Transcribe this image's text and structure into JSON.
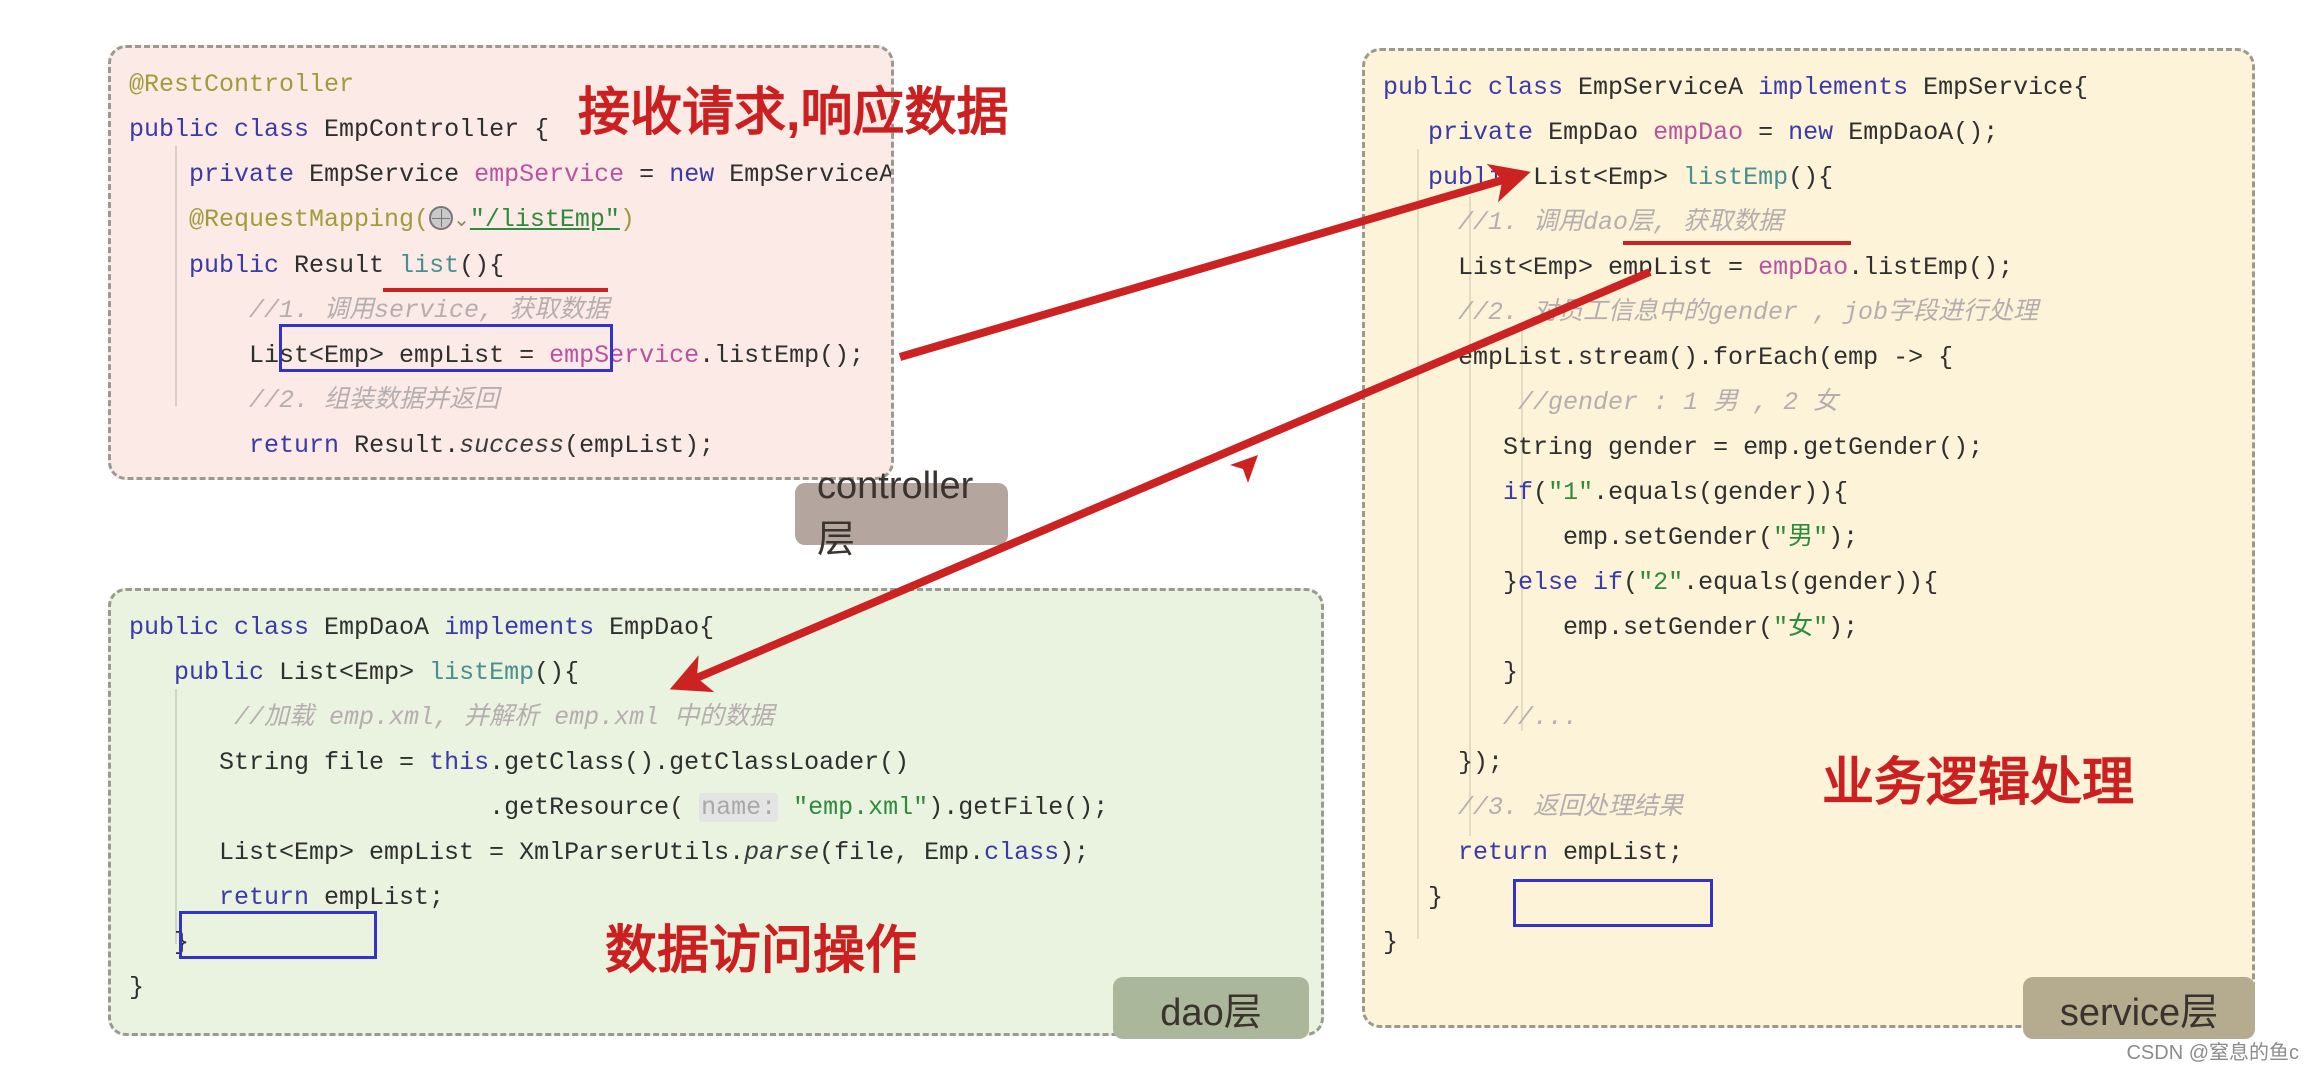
{
  "panels": {
    "controller": {
      "layer_badge": "controller层",
      "annotation": "接收请求,响应数据",
      "background": "#fbeae6",
      "lines": {
        "l1_annotation": "@RestController",
        "l2_class": "public class EmpController {",
        "l3_field": "private EmpService empService = new EmpServiceA();",
        "l4_mapping_prefix": "@RequestMapping(",
        "l4_mapping_path": "\"/listEmp\"",
        "l4_mapping_suffix": ")",
        "l5_method": "public Result list(){",
        "l6_comment": "//1. 调用service, 获取数据",
        "l7_call": "List<Emp> empList = empService.listEmp();",
        "l8_comment": "//2. 组装数据并返回",
        "l9_return": "return Result.success(empList);",
        "l10_brace": "}",
        "l11_brace": "}"
      }
    },
    "dao": {
      "layer_badge": "dao层",
      "annotation": "数据访问操作",
      "background": "#eaf2e0",
      "lines": {
        "l1_class": "public class EmpDaoA implements EmpDao{",
        "l2_method": "public List<Emp> listEmp(){",
        "l3_comment": "//加载 emp.xml, 并解析 emp.xml 中的数据",
        "l4_code": "String file = this.getClass().getClassLoader()",
        "l5_code_prefix": ".getResource(",
        "l5_hint": "name:",
        "l5_code_suffix": "\"emp.xml\").getFile();",
        "l6_code": "List<Emp> empList = XmlParserUtils.parse(file, Emp.class);",
        "l7_return": "return empList;",
        "l8_brace": "}",
        "l9_brace": "}"
      }
    },
    "service": {
      "layer_badge": "service层",
      "annotation": "业务逻辑处理",
      "background": "#fcf3d9",
      "lines": {
        "l1_class": "public class EmpServiceA implements EmpService{",
        "l2_field": "private EmpDao empDao = new EmpDaoA();",
        "l3_method": "public List<Emp> listEmp(){",
        "l4_comment": "//1. 调用dao层, 获取数据",
        "l5_call": "List<Emp> empList = empDao.listEmp();",
        "l6_comment": "//2. 对员工信息中的gender , job字段进行处理",
        "l7_stream": "empList.stream().forEach(emp -> {",
        "l8_comment": "//gender : 1 男 , 2 女",
        "l9_code": "String gender = emp.getGender();",
        "l10_if": "if(\"1\".equals(gender)){",
        "l11_set": "emp.setGender(\"男\");",
        "l12_elseif": "}else if(\"2\".equals(gender)){",
        "l13_set": "emp.setGender(\"女\");",
        "l14_brace": "}",
        "l15_comment": "//...",
        "l16_close": "});",
        "l17_comment": "//3. 返回处理结果",
        "l18_return": "return empList;",
        "l19_brace": "}",
        "l20_brace": "}"
      }
    }
  },
  "colors": {
    "arrow_red": "#cc2222",
    "highlight_blue": "#3333cc",
    "annotation_red": "#cc2020",
    "border_dashed": "#9a9a93"
  },
  "watermark": "CSDN @窒息的鱼c"
}
